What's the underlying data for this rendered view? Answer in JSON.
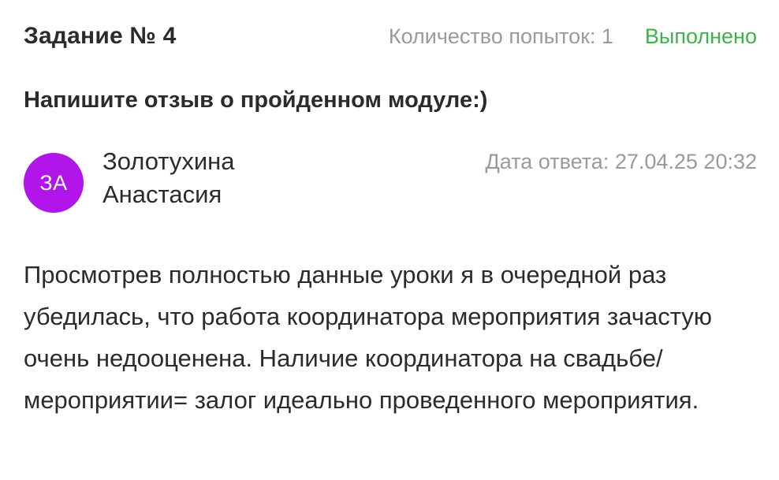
{
  "task": {
    "title": "Задание № 4",
    "attempts": "Количество попыток: 1",
    "status": "Выполнено",
    "question": "Напишите отзыв о пройденном модуле:)"
  },
  "answer": {
    "avatar_initials": "ЗА",
    "author_name": "Золотухина Анастасия",
    "date": "Дата ответа: 27.04.25 20:32",
    "text": "Просмотрев полностью данные уроки я в очередной раз убедилась, что работа координатора мероприятия зачастую очень недооценена. Наличие координатора на свадьбе/мероприятии= залог идеально проведенного мероприятия."
  },
  "colors": {
    "status": "#3db14b",
    "avatar_bg": "#b115ea",
    "muted_text": "#9a9a9a",
    "main_text": "#2b2b2b"
  }
}
